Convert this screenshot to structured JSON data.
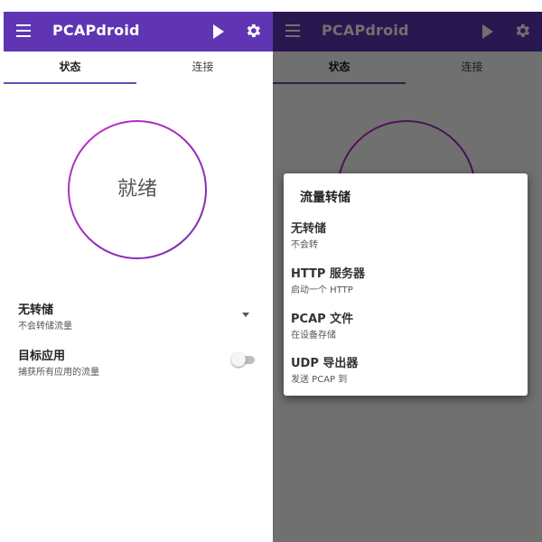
{
  "app": {
    "title": "PCAPdroid"
  },
  "tabs": [
    {
      "label": "状态"
    },
    {
      "label": "连接"
    }
  ],
  "status": {
    "label": "就绪"
  },
  "dump": {
    "title": "无转储",
    "subtitle": "不会转储流量"
  },
  "target_app": {
    "title": "目标应用",
    "subtitle": "捕获所有应用的流量"
  },
  "dialog": {
    "title": "流量转储",
    "options": [
      {
        "title": "无转储",
        "subtitle": "不会转"
      },
      {
        "title": "HTTP 服务器",
        "subtitle": "启动一个 HTTP"
      },
      {
        "title": "PCAP 文件",
        "subtitle": "在设备存储"
      },
      {
        "title": "UDP 导出器",
        "subtitle": "发送 PCAP 到"
      }
    ]
  },
  "colors": {
    "toolbar": "#5f35b4",
    "accent": "#6a4bb8",
    "ring_start": "#c030c8",
    "ring_end": "#7a2bb0"
  }
}
